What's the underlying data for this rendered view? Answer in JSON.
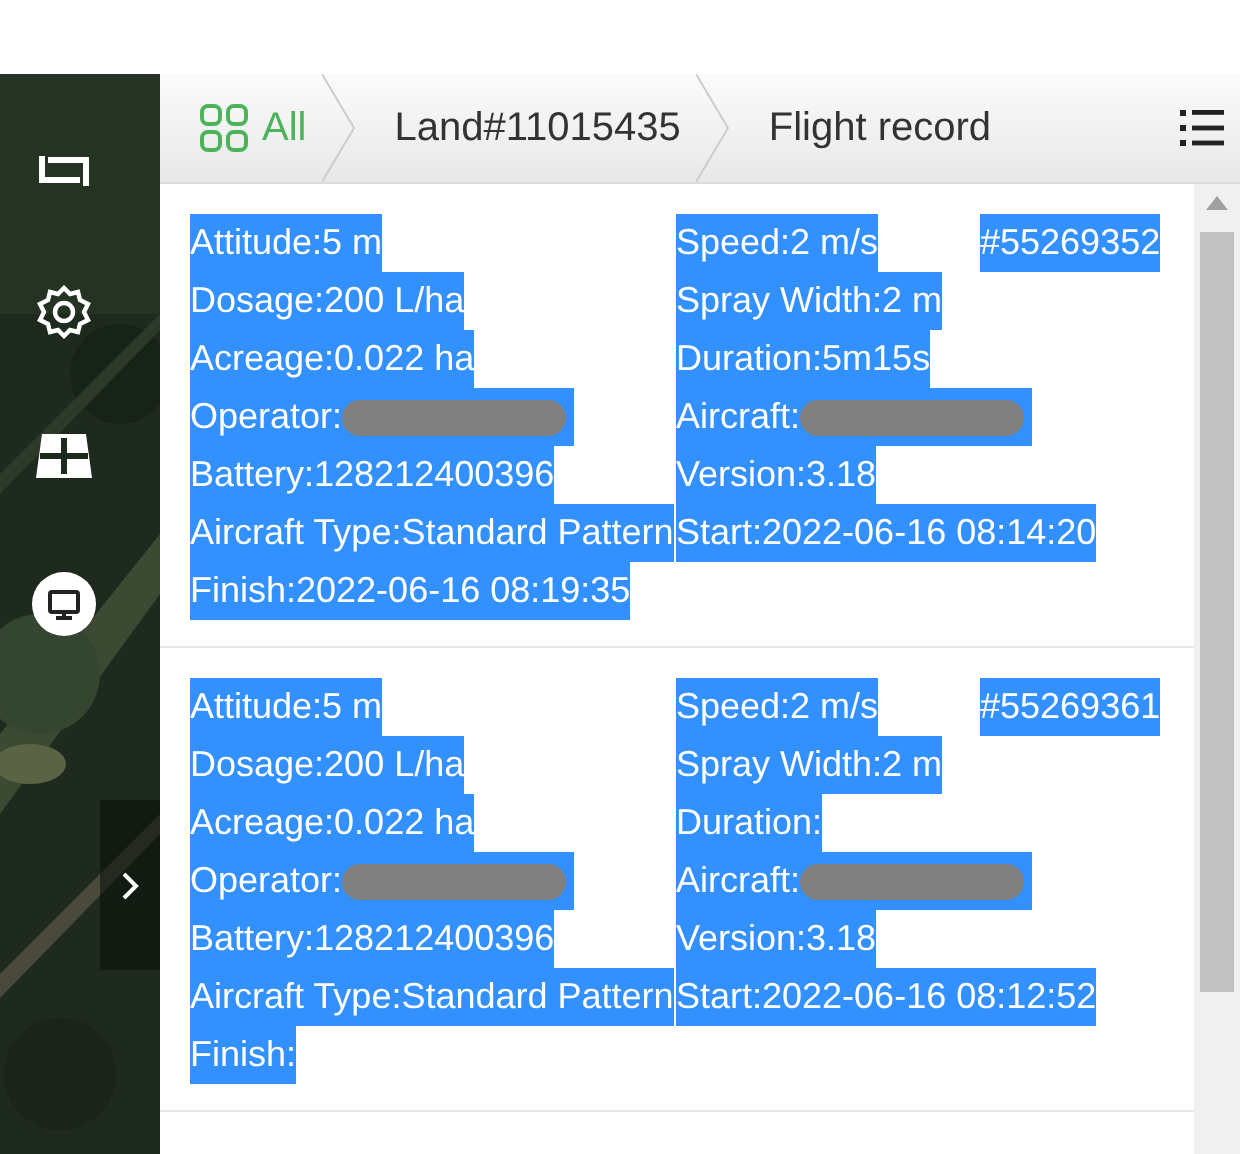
{
  "breadcrumb": [
    {
      "label": "All",
      "kind": "home"
    },
    {
      "label": "Land#11015435",
      "kind": "page"
    },
    {
      "label": "Flight record",
      "kind": "page"
    }
  ],
  "records": [
    {
      "id": "#55269352",
      "highlighted": true,
      "left": [
        {
          "text": "Attitude:5 m"
        },
        {
          "text": "Dosage:200 L/ha"
        },
        {
          "text": "Acreage:0.022 ha"
        },
        {
          "text": "Operator:",
          "redacted": true
        },
        {
          "text": "Battery:128212400396"
        },
        {
          "text": "Aircraft Type:Standard Pattern"
        },
        {
          "text": "Finish:2022-06-16 08:19:35"
        }
      ],
      "right": [
        {
          "text": "Speed:2 m/s"
        },
        {
          "text": "Spray Width:2 m"
        },
        {
          "text": "Duration:5m15s"
        },
        {
          "text": "Aircraft:",
          "redacted": true
        },
        {
          "text": "Version:3.18"
        },
        {
          "text": "Start:2022-06-16 08:14:20"
        }
      ]
    },
    {
      "id": "#55269361",
      "highlighted": true,
      "left": [
        {
          "text": "Attitude:5 m"
        },
        {
          "text": "Dosage:200 L/ha"
        },
        {
          "text": "Acreage:0.022 ha"
        },
        {
          "text": "Operator:",
          "redacted": true
        },
        {
          "text": "Battery:128212400396"
        },
        {
          "text": "Aircraft Type:Standard Pattern"
        },
        {
          "text": "Finish:"
        }
      ],
      "right": [
        {
          "text": "Speed:2 m/s"
        },
        {
          "text": "Spray Width:2 m"
        },
        {
          "text": "Duration:"
        },
        {
          "text": "Aircraft:",
          "redacted": true
        },
        {
          "text": "Version:3.18"
        },
        {
          "text": "Start:2022-06-16 08:12:52"
        }
      ]
    }
  ]
}
